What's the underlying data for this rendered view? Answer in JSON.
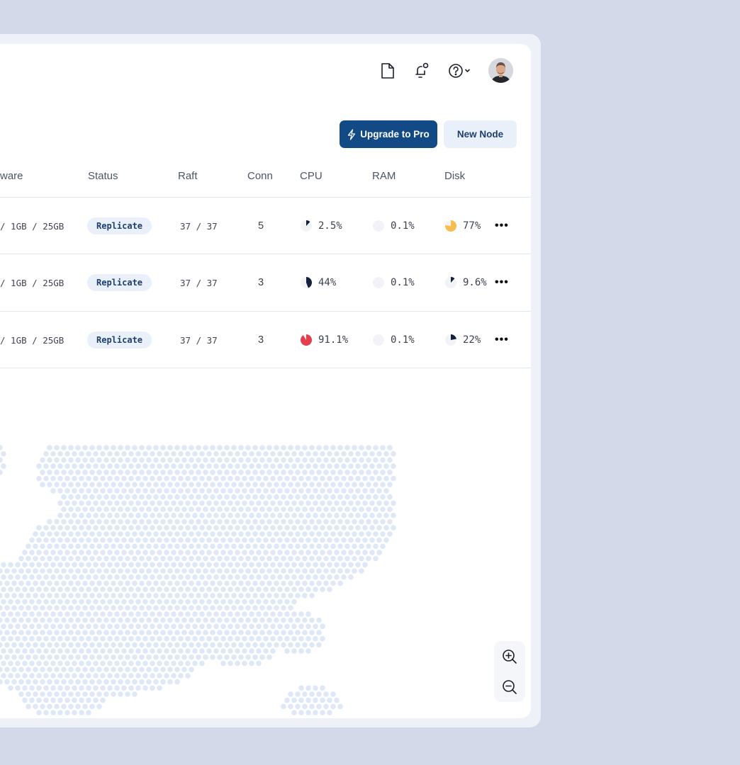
{
  "header": {
    "upgrade_label": "Upgrade to Pro",
    "new_node_label": "New Node"
  },
  "table": {
    "columns": [
      "ware",
      "Status",
      "Raft",
      "Conn",
      "CPU",
      "RAM",
      "Disk"
    ],
    "rows": [
      {
        "hardware": "/ 1GB / 25GB",
        "status": "Replicate",
        "raft": "37 / 37",
        "conn": "5",
        "cpu": "2.5%",
        "cpu_fraction": 0.025,
        "ram": "0.1%",
        "ram_fraction": 0.001,
        "disk": "77%",
        "disk_fraction": 0.77,
        "actions": "•••"
      },
      {
        "hardware": "/ 1GB / 25GB",
        "status": "Replicate",
        "raft": "37 / 37",
        "conn": "3",
        "cpu": "44%",
        "cpu_fraction": 0.44,
        "ram": "0.1%",
        "ram_fraction": 0.001,
        "disk": "9.6%",
        "disk_fraction": 0.096,
        "actions": "•••"
      },
      {
        "hardware": "/ 1GB / 25GB",
        "status": "Replicate",
        "raft": "37 / 37",
        "conn": "3",
        "cpu": "91.1%",
        "cpu_fraction": 0.911,
        "ram": "0.1%",
        "ram_fraction": 0.001,
        "disk": "22%",
        "disk_fraction": 0.22,
        "actions": "•••"
      }
    ]
  },
  "colors": {
    "primary": "#124a86",
    "badge_bg": "#eaf0fa",
    "pie_dark": "#14213d",
    "pie_warn": "#f6bd4f",
    "pie_critical": "#e43f4f",
    "pie_track": "#f1f3f7",
    "map_dot": "#dfe8f6"
  },
  "icons": {
    "docs": "document-icon",
    "notifications": "bell-icon",
    "help": "help-circle-icon",
    "zoom_in": "zoom-in-icon",
    "zoom_out": "zoom-out-icon"
  }
}
